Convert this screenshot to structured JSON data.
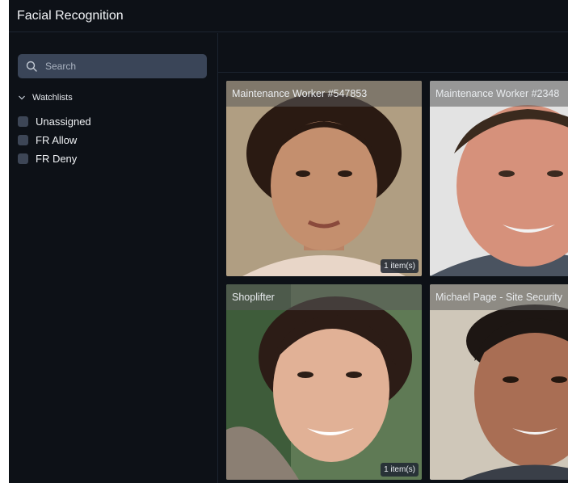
{
  "app": {
    "title": "Facial Recognition"
  },
  "sidebar": {
    "search_placeholder": "Search",
    "watchlists_label": "Watchlists",
    "items": [
      {
        "label": "Unassigned"
      },
      {
        "label": "FR Allow"
      },
      {
        "label": "FR Deny"
      }
    ]
  },
  "cards": [
    {
      "name": "Maintenance Worker #547853",
      "badge": "1 item(s)"
    },
    {
      "name": "Maintenance Worker #2348",
      "badge": ""
    },
    {
      "name": "Shoplifter",
      "badge": "1 item(s)"
    },
    {
      "name": "Michael Page - Site Security",
      "badge": ""
    }
  ],
  "colors": {
    "background": "#0d1117",
    "search_bg": "#3a4558",
    "checkbox": "#3d4656"
  }
}
